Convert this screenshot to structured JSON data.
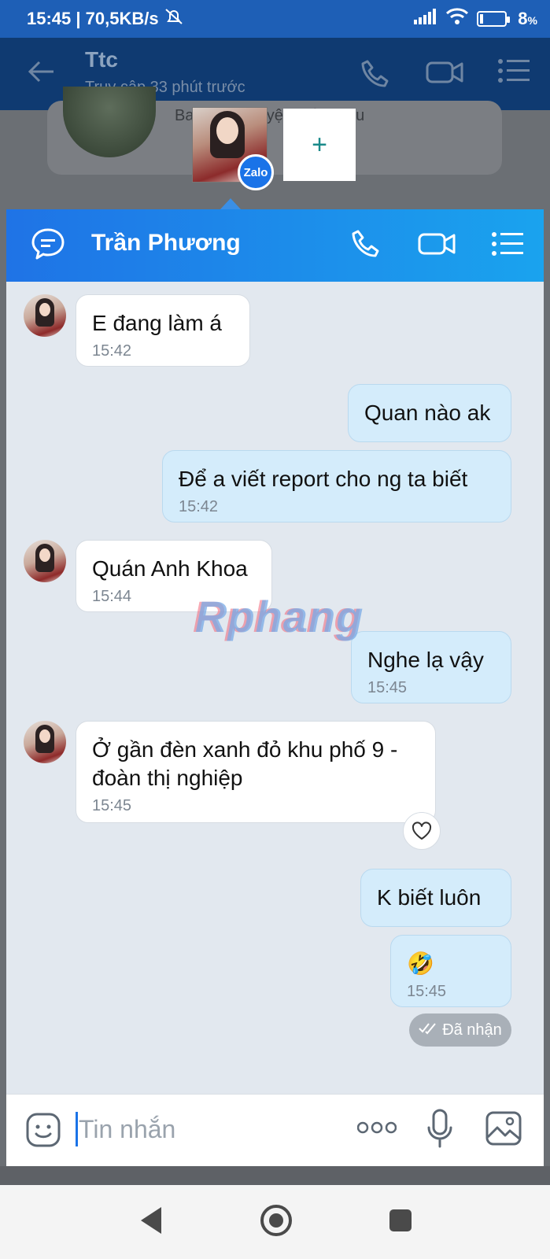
{
  "status_bar": {
    "time_speed": "15:45 | 70,5KB/s",
    "battery": "8",
    "battery_unit": "%"
  },
  "background_chat": {
    "title": "Ttc",
    "subtitle": "Truy cập 33 phút trước",
    "preview_text": "Ba... câu chuyện thú vị ... u"
  },
  "bubble_heads": {
    "badge": "Zalo",
    "add_label": "+"
  },
  "chat": {
    "contact_name": "Trần Phương",
    "messages": [
      {
        "direction": "in",
        "text": "E đang làm á",
        "time": "15:42"
      },
      {
        "direction": "out",
        "text": "Quan nào ak",
        "time": ""
      },
      {
        "direction": "out",
        "text": "Để a viết report cho ng ta biết",
        "time": "15:42"
      },
      {
        "direction": "in",
        "text": "Quán Anh Khoa",
        "time": "15:44"
      },
      {
        "direction": "out",
        "text": "Nghe lạ vậy",
        "time": "15:45"
      },
      {
        "direction": "in",
        "text": "Ở gần đèn xanh đỏ khu phố 9 - đoàn thị nghiệp",
        "time": "15:45"
      },
      {
        "direction": "out",
        "text": "K biết luôn",
        "time": ""
      },
      {
        "direction": "out",
        "text": "🤣",
        "time": "15:45"
      }
    ],
    "received_label": "Đã nhận"
  },
  "watermark": "Rphang",
  "input": {
    "placeholder": "Tin nhắn"
  }
}
